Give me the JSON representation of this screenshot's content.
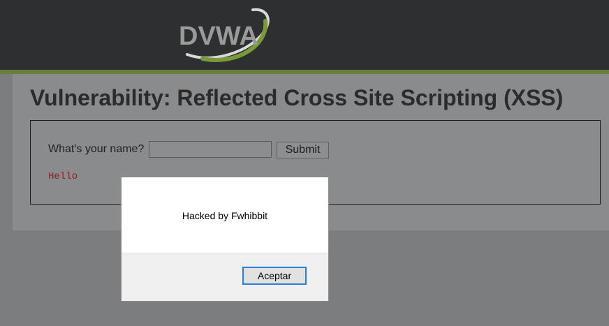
{
  "header": {
    "logo_text": "DVWA"
  },
  "main": {
    "title": "Vulnerability: Reflected Cross Site Scripting (XSS)",
    "form": {
      "label": "What's your name?",
      "input_value": "",
      "submit_label": "Submit"
    },
    "output": "Hello"
  },
  "alert": {
    "message": "Hacked by Fwhibbit",
    "ok_label": "Aceptar"
  },
  "colors": {
    "header_bg": "#2e2f30",
    "accent_stripe": "#6b7d3c",
    "output_text": "#8b2222",
    "dialog_focus": "#2b7fd6"
  }
}
